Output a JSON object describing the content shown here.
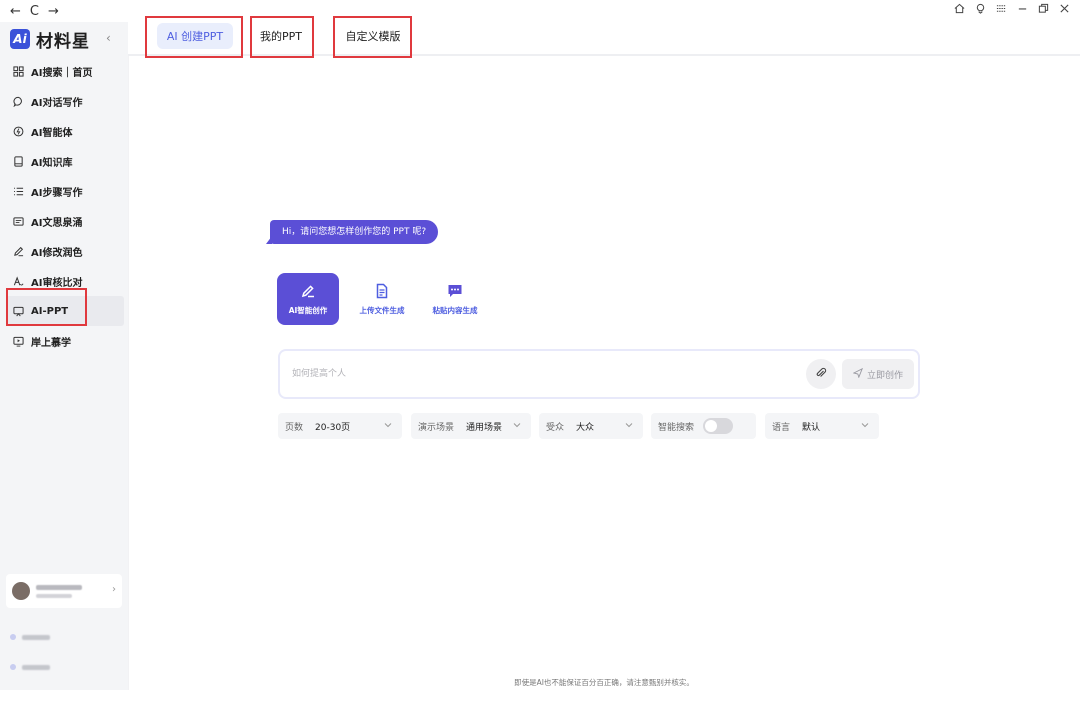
{
  "browser": {
    "back_glyph": "←",
    "reload_glyph": "C",
    "forward_glyph": "→"
  },
  "window_controls": {
    "icons": [
      "home-icon",
      "location-icon",
      "menu-icon",
      "minimize-icon",
      "restore-icon",
      "close-icon"
    ]
  },
  "app": {
    "logo_badge": "Ai",
    "name": "材料星"
  },
  "sidebar": {
    "items": [
      {
        "label": "AI搜索｜首页",
        "icon": "grid-icon"
      },
      {
        "label": "AI对话写作",
        "icon": "chat-icon"
      },
      {
        "label": "AI智能体",
        "icon": "agent-icon"
      },
      {
        "label": "AI知识库",
        "icon": "book-icon"
      },
      {
        "label": "AI步骤写作",
        "icon": "list-icon"
      },
      {
        "label": "AI文思泉涌",
        "icon": "document-icon"
      },
      {
        "label": "AI修改润色",
        "icon": "pen-icon"
      },
      {
        "label": "AI审核比对",
        "icon": "compare-icon"
      },
      {
        "label": "AI-PPT",
        "icon": "presentation-icon",
        "active": true
      },
      {
        "label": "岸上慕学",
        "icon": "monitor-icon"
      }
    ]
  },
  "tabs": [
    {
      "label": "AI 创建PPT",
      "active": true
    },
    {
      "label": "我的PPT",
      "active": false
    },
    {
      "label": "自定义模版",
      "active": false
    }
  ],
  "main": {
    "greeting": "Hi，请问您想怎样创作您的 PPT 呢?",
    "modes": [
      {
        "label": "AI智能创作",
        "icon": "magic-pen-icon",
        "active": true
      },
      {
        "label": "上传文件生成",
        "icon": "file-icon",
        "active": false
      },
      {
        "label": "粘贴内容生成",
        "icon": "paste-chat-icon",
        "active": false
      }
    ],
    "input": {
      "placeholder": "如何提高个人",
      "value": "",
      "submit_label": "立即创作"
    },
    "options": {
      "pages": {
        "label": "页数",
        "value": "20-30页"
      },
      "scene": {
        "label": "演示场景",
        "value": "通用场景"
      },
      "audience": {
        "label": "受众",
        "value": "大众"
      },
      "smart_search": {
        "label": "智能搜索",
        "enabled": false
      },
      "language": {
        "label": "语言",
        "value": "默认"
      }
    },
    "disclaimer": "即使是AI也不能保证百分百正确，请注意甄别并核实。"
  },
  "colors": {
    "accent": "#5b4fd6",
    "brand_blue": "#3b52d9",
    "highlight_red": "#e0393e",
    "sidebar_bg": "#f4f5f7"
  }
}
